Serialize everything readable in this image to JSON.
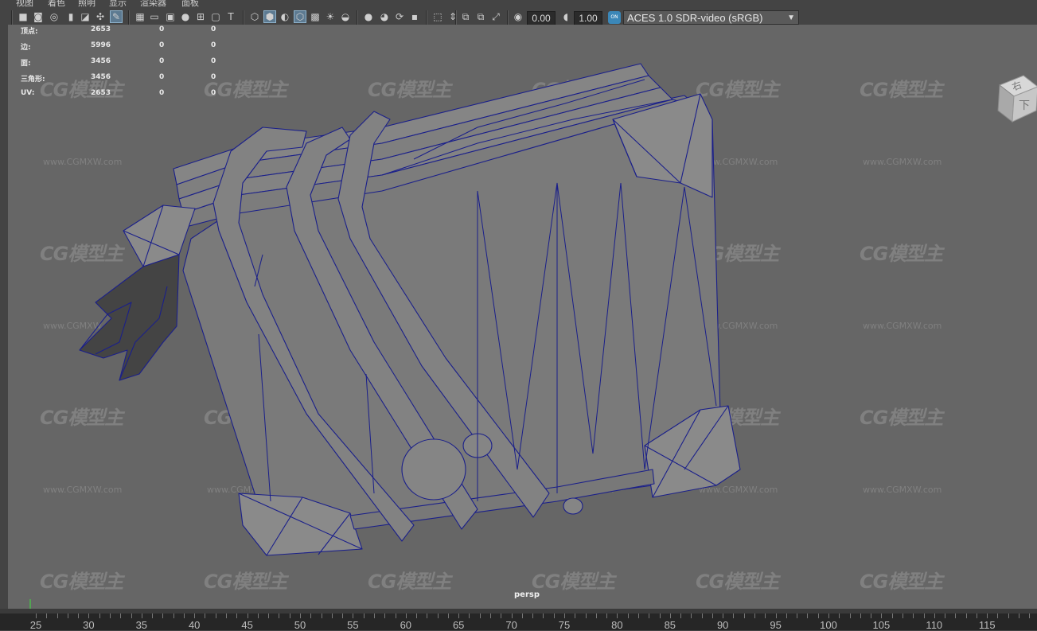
{
  "menus": [
    "视图",
    "着色",
    "照明",
    "显示",
    "渲染器",
    "面板"
  ],
  "toolbar": {
    "exposure_value": "0.00",
    "gamma_value": "1.00",
    "color_badge": "ON",
    "color_management": "ACES 1.0 SDR-video (sRGB)"
  },
  "hud": {
    "rows": [
      {
        "label": "顶点:",
        "v1": "2653",
        "v2": "0",
        "v3": "0"
      },
      {
        "label": "边:",
        "v1": "5996",
        "v2": "0",
        "v3": "0"
      },
      {
        "label": "面:",
        "v1": "3456",
        "v2": "0",
        "v3": "0"
      },
      {
        "label": "三角形:",
        "v1": "3456",
        "v2": "0",
        "v3": "0"
      },
      {
        "label": "UV:",
        "v1": "2653",
        "v2": "0",
        "v3": "0"
      }
    ]
  },
  "watermark": {
    "logo": "CG模型主",
    "url": "www.CGMXW.com"
  },
  "viewcube": {
    "top_face": "右",
    "front_face": "下"
  },
  "viewport": {
    "camera": "persp"
  },
  "timeline": {
    "ticks": [
      "25",
      "30",
      "35",
      "40",
      "45",
      "50",
      "55",
      "60",
      "65",
      "70",
      "75",
      "80",
      "85",
      "90",
      "95",
      "100",
      "105",
      "110",
      "115"
    ]
  },
  "colors": {
    "wire": "#1a1f8a",
    "viewport_bg": "#666666",
    "model_fill": "#7b7b7b",
    "accent": "#3b87b8"
  }
}
